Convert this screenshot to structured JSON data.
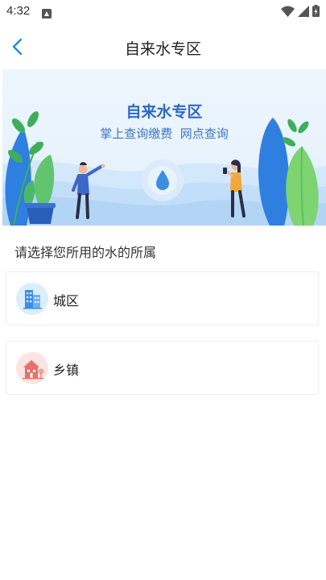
{
  "status": {
    "time": "4:32"
  },
  "nav": {
    "title": "自来水专区",
    "back_icon": "chevron-left-icon"
  },
  "banner": {
    "title": "自来水专区",
    "subtitle": "掌上查询缴费  网点查询"
  },
  "section": {
    "label": "请选择您所用的水的所属"
  },
  "options": [
    {
      "label": "城区",
      "icon": "city-building-icon",
      "color": "#3a8fe0"
    },
    {
      "label": "乡镇",
      "icon": "town-house-icon",
      "color": "#e8706a"
    }
  ],
  "colors": {
    "accent": "#2e68c8",
    "back": "#1f8ae6"
  }
}
